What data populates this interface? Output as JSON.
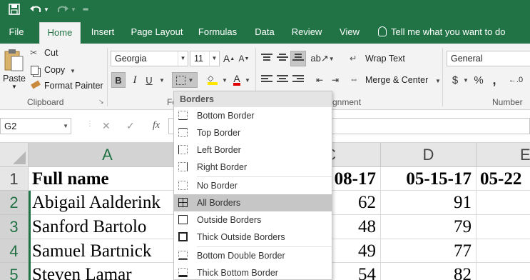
{
  "quick_access": {
    "save_icon": "save-icon",
    "undo_icon": "undo-icon",
    "redo_icon": "redo-icon",
    "customize_icon": "customize-icon"
  },
  "tabs": [
    "File",
    "Home",
    "Insert",
    "Page Layout",
    "Formulas",
    "Data",
    "Review",
    "View"
  ],
  "tell_me": "Tell me what you want to do",
  "ribbon": {
    "clipboard": {
      "paste": "Paste",
      "cut": "Cut",
      "copy": "Copy",
      "format_painter": "Format Painter",
      "group_label": "Clipboard"
    },
    "font": {
      "name": "Georgia",
      "size": "11",
      "bold": "B",
      "italic": "I",
      "underline": "U",
      "grow": "A",
      "shrink": "A",
      "group_label": "Fo"
    },
    "alignment": {
      "wrap_text": "Wrap Text",
      "merge_center": "Merge & Center",
      "group_label": "gnment"
    },
    "number": {
      "format": "General",
      "currency": "$",
      "percent": "%",
      "comma": ",",
      "group_label": "Number"
    }
  },
  "formula_bar": {
    "name_box": "G2",
    "cancel": "✕",
    "enter": "✓",
    "fx": "fx",
    "value": ""
  },
  "columns": [
    "A",
    "C",
    "D",
    "E"
  ],
  "rows": [
    "1",
    "2",
    "3",
    "4",
    "5"
  ],
  "cells": {
    "headers": [
      "Full name",
      "08-17",
      "05-15-17",
      "05-22"
    ],
    "names": [
      "Abigail Aalderink",
      "Sanford Bartolo",
      "Samuel Bartnick",
      "Steven Lamar"
    ],
    "c_values": [
      "62",
      "48",
      "49",
      "54"
    ],
    "d_values": [
      "91",
      "79",
      "77",
      "82"
    ]
  },
  "borders_menu": {
    "title": "Borders",
    "items": [
      "Bottom Border",
      "Top Border",
      "Left Border",
      "Right Border",
      "No Border",
      "All Borders",
      "Outside Borders",
      "Thick Outside Borders",
      "Bottom Double Border",
      "Thick Bottom Border"
    ],
    "highlighted": "All Borders"
  },
  "colors": {
    "excel_green": "#217346",
    "ribbon_bg": "#f3f3f3",
    "highlight": "#c6c6c6"
  }
}
